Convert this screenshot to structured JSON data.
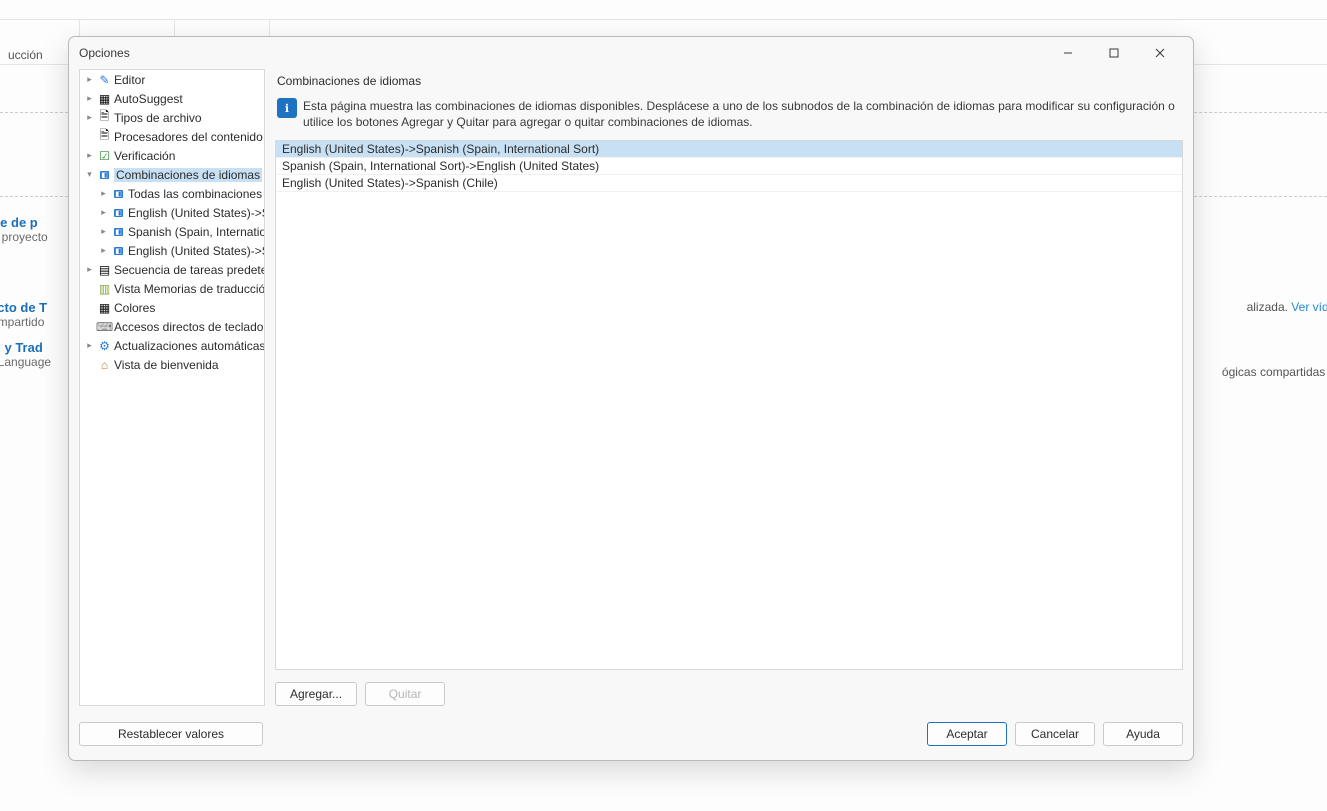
{
  "bg": {
    "tab_title": "ucción",
    "panels": [
      {
        "h": "iete de p",
        "p": "de proyecto"
      },
      {
        "h": "recto de T",
        "p": "compartido"
      },
      {
        "h": "ud y Trad",
        "p": "le Language"
      }
    ],
    "right1a": "alizada. ",
    "right1b": "Ver vídeo",
    "right2": "ógicas compartidas on"
  },
  "dialog": {
    "title": "Opciones",
    "tree": [
      {
        "level": 0,
        "expander": "▸",
        "icon": "pencil",
        "label": "Editor"
      },
      {
        "level": 0,
        "expander": "▸",
        "icon": "auto",
        "label": "AutoSuggest"
      },
      {
        "level": 0,
        "expander": "▸",
        "icon": "file",
        "label": "Tipos de archivo"
      },
      {
        "level": 0,
        "expander": "",
        "icon": "file",
        "label": "Procesadores del contenido in"
      },
      {
        "level": 0,
        "expander": "▸",
        "icon": "check",
        "label": "Verificación"
      },
      {
        "level": 0,
        "expander": "▾",
        "icon": "lang",
        "label": "Combinaciones de idiomas",
        "selected": true
      },
      {
        "level": 1,
        "expander": "▸",
        "icon": "lang",
        "label": "Todas las combinaciones d"
      },
      {
        "level": 1,
        "expander": "▸",
        "icon": "lang",
        "label": "English (United States)->Sp"
      },
      {
        "level": 1,
        "expander": "▸",
        "icon": "lang",
        "label": "Spanish (Spain, Internation"
      },
      {
        "level": 1,
        "expander": "▸",
        "icon": "lang",
        "label": "English (United States)->Sp"
      },
      {
        "level": 0,
        "expander": "▸",
        "icon": "seq",
        "label": "Secuencia de tareas predeter"
      },
      {
        "level": 0,
        "expander": "",
        "icon": "tm",
        "label": "Vista Memorias de traducción"
      },
      {
        "level": 0,
        "expander": "",
        "icon": "colors",
        "label": "Colores"
      },
      {
        "level": 0,
        "expander": "",
        "icon": "kbd",
        "label": "Accesos directos de teclado"
      },
      {
        "level": 0,
        "expander": "▸",
        "icon": "update",
        "label": "Actualizaciones automáticas"
      },
      {
        "level": 0,
        "expander": "",
        "icon": "home",
        "label": "Vista de bienvenida"
      }
    ],
    "content": {
      "heading": "Combinaciones de idiomas",
      "info": "Esta página muestra las combinaciones de idiomas disponibles. Desplácese a uno de los subnodos de la combinación de idiomas para modificar su configuración o utilice los botones Agregar y Quitar para agregar o quitar combinaciones de idiomas.",
      "rows": [
        {
          "text": "English (United States)->Spanish (Spain, International Sort)",
          "selected": true
        },
        {
          "text": "Spanish (Spain, International Sort)->English (United States)",
          "selected": false
        },
        {
          "text": "English (United States)->Spanish (Chile)",
          "selected": false
        }
      ],
      "add": "Agregar...",
      "remove": "Quitar"
    },
    "footer": {
      "reset": "Restablecer valores",
      "ok": "Aceptar",
      "cancel": "Cancelar",
      "help": "Ayuda"
    }
  }
}
